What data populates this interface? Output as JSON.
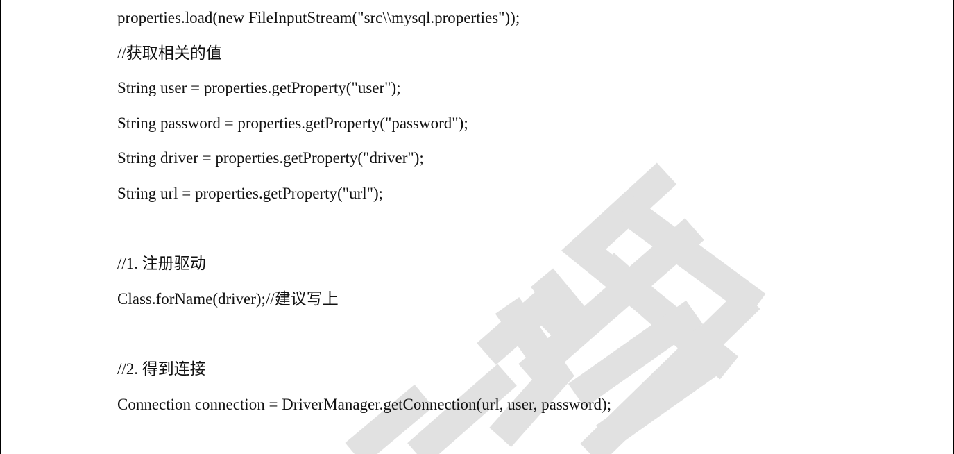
{
  "document": {
    "watermark_text": "教育",
    "lines": [
      "properties.load(new FileInputStream(\"src\\\\mysql.properties\"));",
      "//获取相关的值",
      "String user = properties.getProperty(\"user\");",
      "String password = properties.getProperty(\"password\");",
      "String driver = properties.getProperty(\"driver\");",
      "String url = properties.getProperty(\"url\");",
      "",
      "//1. 注册驱动",
      "Class.forName(driver);//建议写上",
      "",
      "//2. 得到连接",
      "Connection connection = DriverManager.getConnection(url, user, password);"
    ]
  }
}
